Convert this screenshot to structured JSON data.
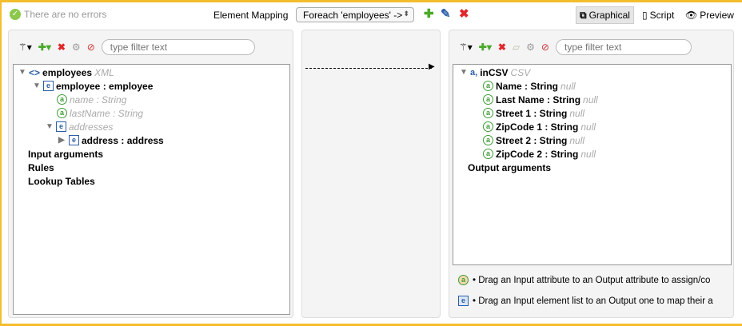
{
  "status": {
    "text": "There are no errors"
  },
  "header": {
    "element_mapping_label": "Element Mapping",
    "selected_mapping": "Foreach 'employees' ->",
    "modes": {
      "graphical": "Graphical",
      "script": "Script",
      "preview": "Preview"
    }
  },
  "left": {
    "filter_placeholder": "type filter text",
    "tree": [
      {
        "label": "employees",
        "type": "XML"
      },
      {
        "label": "employee : employee"
      },
      {
        "label": "name : String"
      },
      {
        "label": "lastName : String"
      },
      {
        "label": "addresses"
      },
      {
        "label": "address : address"
      },
      {
        "label": "Input arguments"
      },
      {
        "label": "Rules"
      },
      {
        "label": "Lookup Tables"
      }
    ]
  },
  "right": {
    "filter_placeholder": "type filter text",
    "root": {
      "label": "inCSV",
      "type": "CSV"
    },
    "attributes": [
      {
        "label": "Name : String",
        "value": "null"
      },
      {
        "label": "Last Name : String",
        "value": "null"
      },
      {
        "label": "Street 1 : String",
        "value": "null"
      },
      {
        "label": "ZipCode 1 : String",
        "value": "null"
      },
      {
        "label": "Street 2 : String",
        "value": "null"
      },
      {
        "label": "ZipCode 2 : String",
        "value": "null"
      }
    ],
    "output_arguments": "Output arguments",
    "hints": [
      "• Drag an Input attribute to an Output attribute to assign/co",
      "• Drag an Input element list to an Output one to map their a"
    ]
  }
}
